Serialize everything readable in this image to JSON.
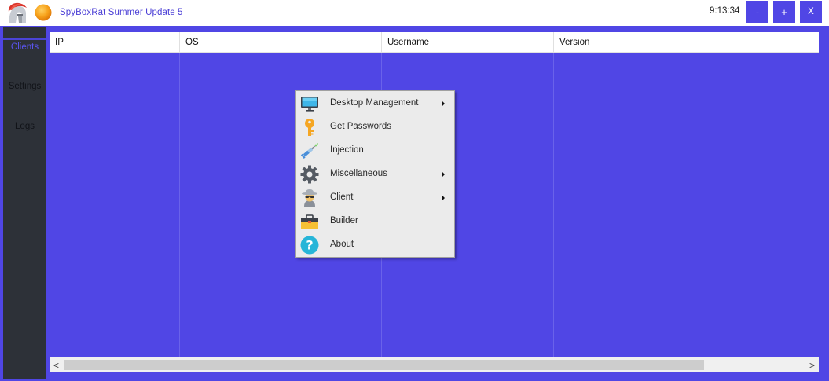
{
  "window": {
    "title": "SpyBoxRat Summer Update 5",
    "clock": "9:13:34",
    "minimize_label": "-",
    "maximize_label": "+",
    "close_label": "X"
  },
  "sidebar": {
    "items": [
      {
        "label": "Clients"
      },
      {
        "label": "Settings"
      },
      {
        "label": "Logs"
      }
    ]
  },
  "table": {
    "columns": [
      "IP",
      "OS",
      "Username",
      "Version"
    ],
    "rows": []
  },
  "scrollbar": {
    "left_arrow": "<",
    "right_arrow": ">"
  },
  "context_menu": {
    "items": [
      {
        "label": "Desktop Management",
        "icon": "monitor-icon",
        "submenu": true
      },
      {
        "label": "Get Passwords",
        "icon": "key-icon",
        "submenu": false
      },
      {
        "label": "Injection",
        "icon": "syringe-icon",
        "submenu": false
      },
      {
        "label": "Miscellaneous",
        "icon": "gear-icon",
        "submenu": true
      },
      {
        "label": "Client",
        "icon": "spy-icon",
        "submenu": true
      },
      {
        "label": "Builder",
        "icon": "toolbox-icon",
        "submenu": false
      },
      {
        "label": "About",
        "icon": "help-icon",
        "submenu": false
      }
    ]
  },
  "colors": {
    "accent": "#5046e5",
    "sidebar_bg": "#2d3138",
    "menu_bg": "#ebebeb"
  }
}
